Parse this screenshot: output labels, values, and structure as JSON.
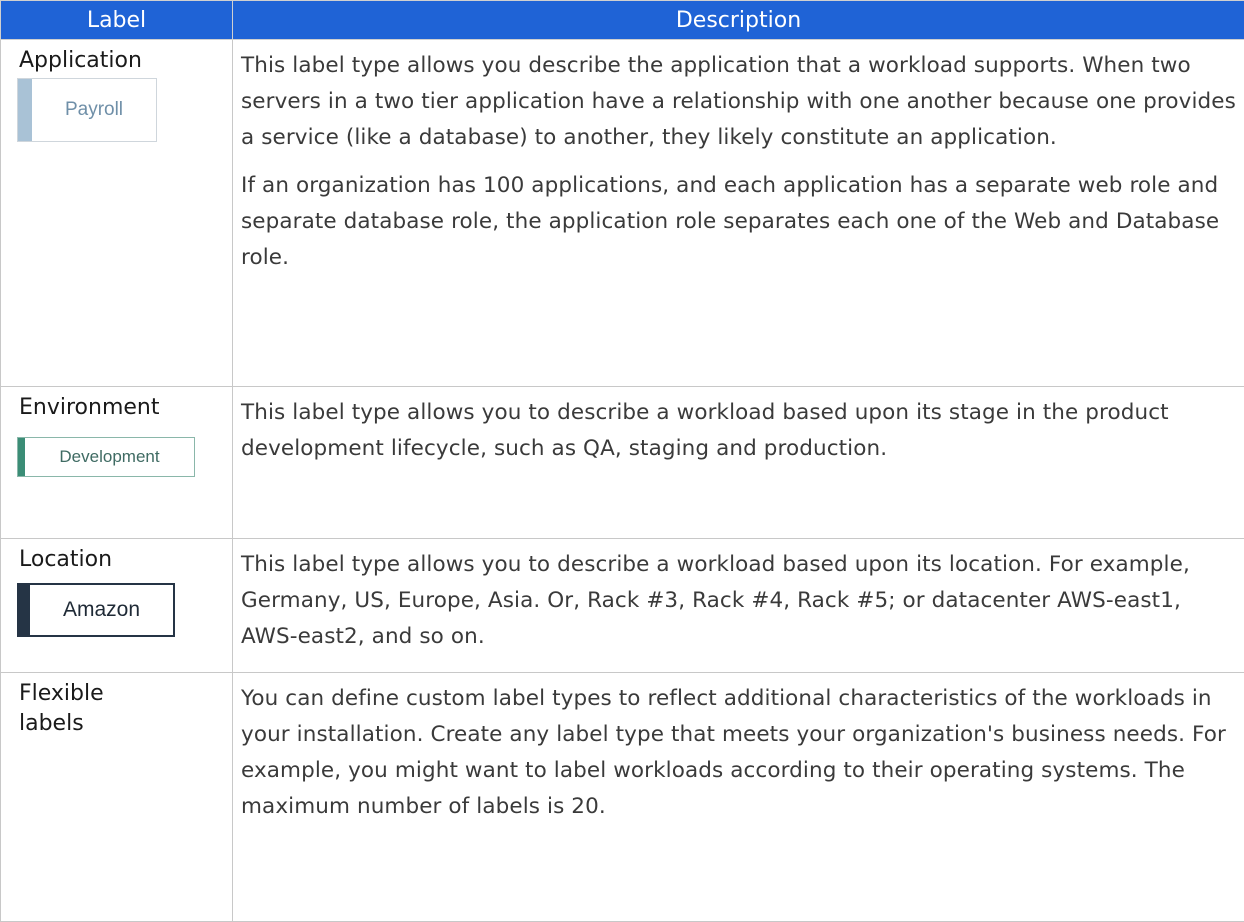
{
  "table": {
    "headers": [
      "Label",
      "Description"
    ],
    "rows": [
      {
        "label": "Application",
        "chip": {
          "text": "Payroll",
          "bar_color": "#a9c2d6",
          "text_color": "#6f8fa8"
        },
        "paragraphs": [
          "This label type allows you describe the application that a workload supports. When two servers in a two tier application have a relationship with one another because one provides a service (like a database) to another, they likely constitute an application.",
          "If an organization has 100 applications, and each application has a separate web role and separate database role, the application role separates each one of the Web and Database role."
        ]
      },
      {
        "label": "Environment",
        "chip": {
          "text": "Development",
          "bar_color": "#3b8d76",
          "text_color": "#3f6b63"
        },
        "paragraphs": [
          "This label type allows you to describe a workload based upon its stage in the product development lifecycle, such as QA, staging and production."
        ]
      },
      {
        "label": "Location",
        "chip": {
          "text": "Amazon",
          "bar_color": "#253445",
          "text_color": "#1f2a36"
        },
        "paragraphs": [
          "This label type allows you to describe a workload based upon its location. For example, Germany, US, Europe, Asia. Or, Rack #3, Rack #4, Rack #5; or datacenter AWS-east1, AWS-east2, and so on."
        ]
      },
      {
        "label": "Flexible labels",
        "paragraphs": [
          "You can define custom label types to reflect additional characteristics of the workloads in your installation. Create any label type that meets your organization's business needs. For example, you might want to label workloads according to their operating systems. The maximum number of labels is 20."
        ]
      }
    ]
  },
  "colors": {
    "header_bg": "#1f63d6",
    "header_text": "#ffffff",
    "border": "#c8c8c8",
    "body_text": "#3a3a3a"
  }
}
